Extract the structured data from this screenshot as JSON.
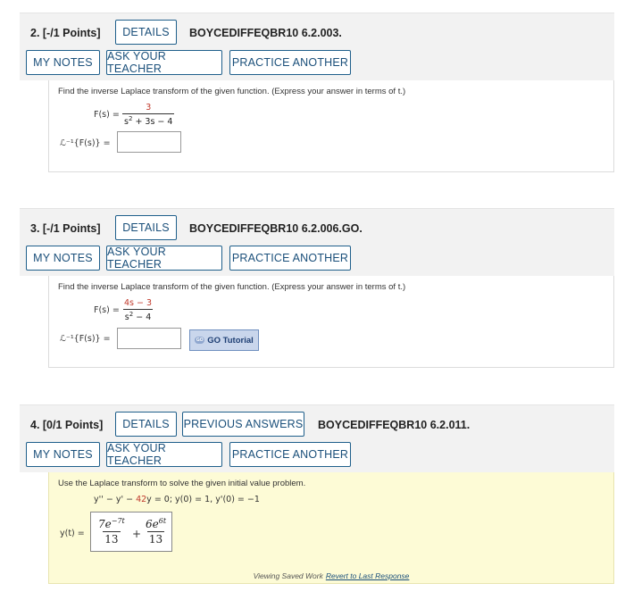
{
  "questions": [
    {
      "title": "2.  [-/1 Points]",
      "details_label": "DETAILS",
      "code": "BOYCEDIFFEQBR10 6.2.003.",
      "my_notes": "MY NOTES",
      "ask_teacher": "ASK YOUR TEACHER",
      "practice": "PRACTICE ANOTHER",
      "prompt": "Find the inverse Laplace transform of the given function. (Express your answer in terms of t.)",
      "lhs": "F(s) =",
      "numerator": "3",
      "denominator_a": "s",
      "denominator_b": "2",
      "denominator_c": " + 3s − 4",
      "answer_label": "ℒ⁻¹{F(s)} ="
    },
    {
      "title": "3.  [-/1 Points]",
      "details_label": "DETAILS",
      "code": "BOYCEDIFFEQBR10 6.2.006.GO.",
      "my_notes": "MY NOTES",
      "ask_teacher": "ASK YOUR TEACHER",
      "practice": "PRACTICE ANOTHER",
      "prompt": "Find the inverse Laplace transform of the given function. (Express your answer in terms of t.)",
      "lhs": "F(s) =",
      "numerator": "4s − 3",
      "denominator_a": "s",
      "denominator_b": "2",
      "denominator_c": " − 4",
      "answer_label": "ℒ⁻¹{F(s)} =",
      "go_tutorial": "GO Tutorial",
      "go_icon": "GO"
    },
    {
      "title": "4.  [0/1 Points]",
      "details_label": "DETAILS",
      "previous_answers": "PREVIOUS ANSWERS",
      "code": "BOYCEDIFFEQBR10 6.2.011.",
      "my_notes": "MY NOTES",
      "ask_teacher": "ASK YOUR TEACHER",
      "practice": "PRACTICE ANOTHER",
      "prompt": "Use the Laplace transform to solve the given initial value problem.",
      "equation_a": "y'' − y' − ",
      "equation_red": "42",
      "equation_b": "y = 0;   y(0) = 1,   y'(0) = −1",
      "answer_label": "y(t) =",
      "ans1_num": "7e",
      "ans1_exp": "−7t",
      "ans1_den": "13",
      "plus": "+",
      "ans2_num": "6e",
      "ans2_exp": "6t",
      "ans2_den": "13",
      "footer_text": "Viewing Saved Work",
      "footer_link": "Revert to Last Response"
    }
  ],
  "colors": {
    "button_border": "#1f5f8b",
    "header_bg": "#f2f2f2",
    "yellow_bg": "#fdfbd6",
    "red": "#c0392b"
  }
}
